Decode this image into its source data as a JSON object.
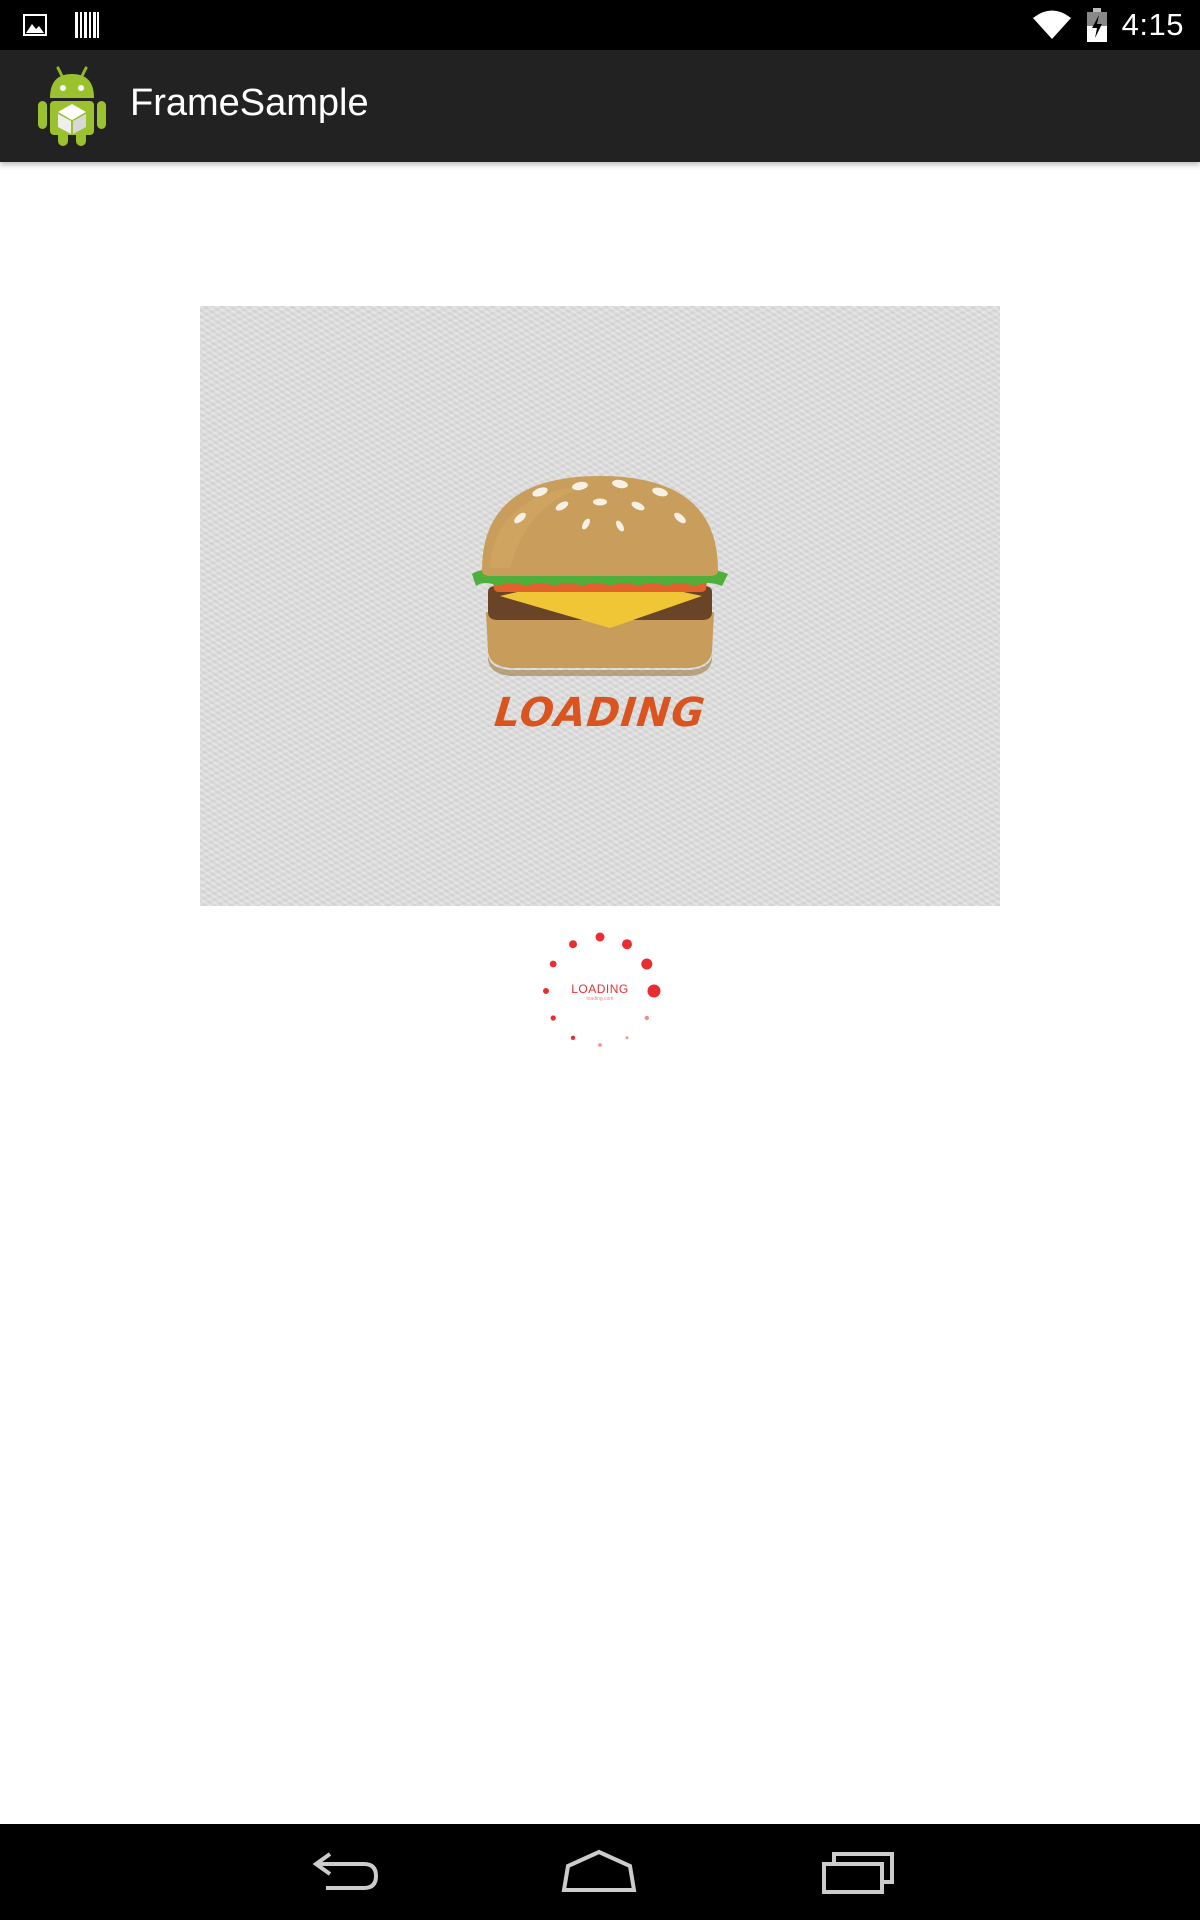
{
  "status_bar": {
    "time": "4:15",
    "left_icons": [
      "gallery-icon",
      "barcode-icon"
    ],
    "right_icons": [
      "wifi-icon",
      "battery-charging-icon"
    ]
  },
  "action_bar": {
    "title": "FrameSample",
    "icon": "android-app-icon"
  },
  "content": {
    "image_caption": "LOADING",
    "spinner_label": "LOADING",
    "spinner_sublabel": "loading.com"
  },
  "nav_bar": {
    "buttons": [
      "back-icon",
      "home-icon",
      "recents-icon"
    ]
  },
  "colors": {
    "status_bar_bg": "#000000",
    "action_bar_bg": "#222222",
    "loading_text": "#d9541e",
    "spinner_red": "#e8161c",
    "nav_bar_bg": "#000000"
  }
}
